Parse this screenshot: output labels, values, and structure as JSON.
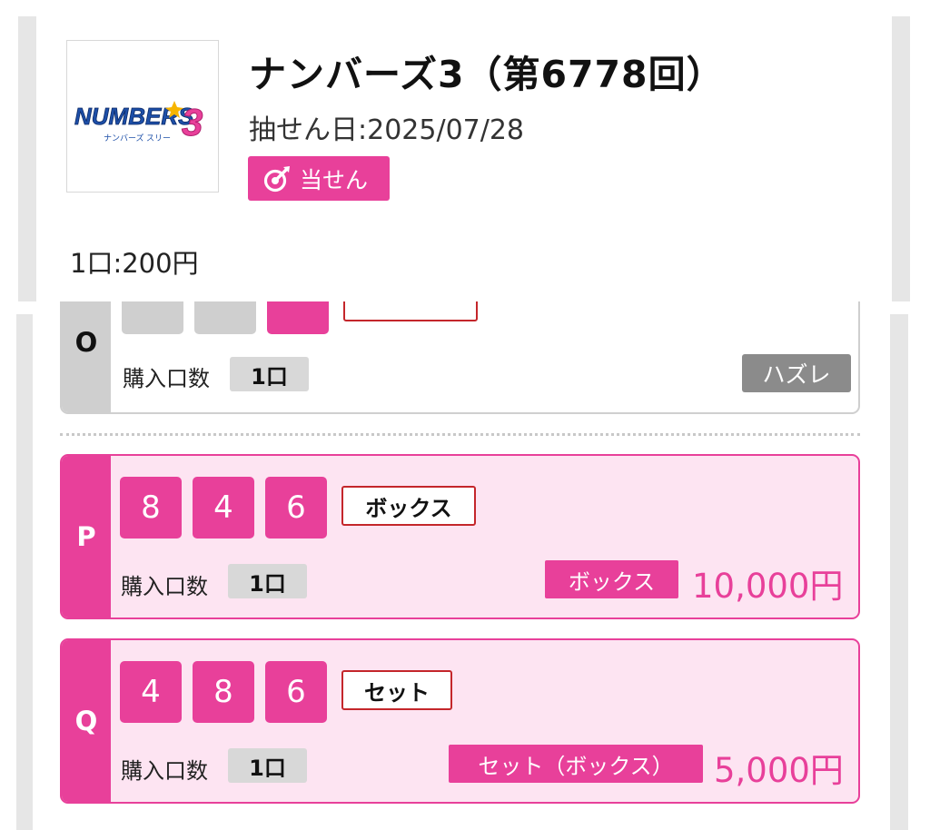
{
  "header": {
    "logo": {
      "text": "NUMBERS3",
      "subtext": "ナンバーズ スリー"
    },
    "title": "ナンバーズ3（第6778回）",
    "draw_date_label": "抽せん日:",
    "draw_date": "2025/07/28",
    "result_badge": "当せん",
    "price_label": "1口:",
    "price": "200円"
  },
  "colors": {
    "accent": "#e8409a",
    "accent_bg": "#fde4f2",
    "type_border": "#c4262b",
    "miss": "#8b8b8b",
    "neutral": "#cfcfcf"
  },
  "entries": [
    {
      "label": "O",
      "numbers": [
        "",
        "",
        ""
      ],
      "type": "",
      "qty_label": "購入口数",
      "qty": "1口",
      "result": "ハズレ"
    },
    {
      "label": "P",
      "numbers": [
        "8",
        "4",
        "6"
      ],
      "type": "ボックス",
      "qty_label": "購入口数",
      "qty": "1口",
      "prize_type": "ボックス",
      "prize_amount": "10,000円"
    },
    {
      "label": "Q",
      "numbers": [
        "4",
        "8",
        "6"
      ],
      "type": "セット",
      "qty_label": "購入口数",
      "qty": "1口",
      "prize_type": "セット（ボックス）",
      "prize_amount": "5,000円"
    }
  ]
}
